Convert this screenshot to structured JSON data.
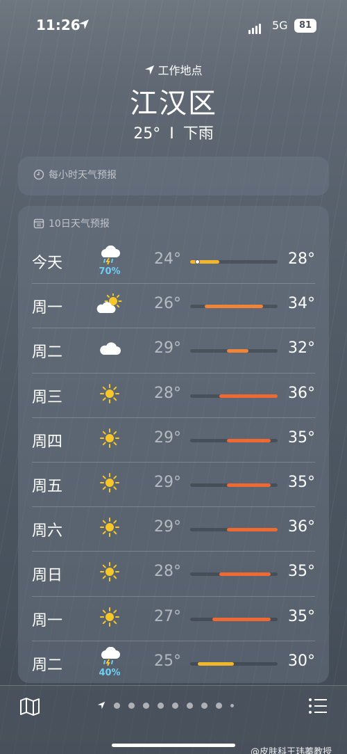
{
  "status": {
    "time": "11:26",
    "network": "5G",
    "battery": "81"
  },
  "header": {
    "location_label": "工作地点",
    "city": "江汉区",
    "temp": "25°",
    "separator": "I",
    "condition": "下雨"
  },
  "hourly": {
    "title": "每小时天气预报"
  },
  "daily": {
    "title": "10日天气预报",
    "range": [
      24,
      36
    ],
    "colors": {
      "cool": "#f2b62a",
      "warm": "#f18436",
      "hot": "#ef6a32",
      "precip": "#6ecff6"
    },
    "rows": [
      {
        "day": "今天",
        "icon": "thunderstorm-icon",
        "precip": "70%",
        "low": "24°",
        "high": "28°",
        "lo_v": 24,
        "hi_v": 28,
        "current": 25
      },
      {
        "day": "周一",
        "icon": "partly-sunny-icon",
        "precip": "",
        "low": "26°",
        "high": "34°",
        "lo_v": 26,
        "hi_v": 34
      },
      {
        "day": "周二",
        "icon": "cloudy-icon",
        "precip": "",
        "low": "29°",
        "high": "32°",
        "lo_v": 29,
        "hi_v": 32
      },
      {
        "day": "周三",
        "icon": "sunny-icon",
        "precip": "",
        "low": "28°",
        "high": "36°",
        "lo_v": 28,
        "hi_v": 36
      },
      {
        "day": "周四",
        "icon": "sunny-icon",
        "precip": "",
        "low": "29°",
        "high": "35°",
        "lo_v": 29,
        "hi_v": 35
      },
      {
        "day": "周五",
        "icon": "sunny-icon",
        "precip": "",
        "low": "29°",
        "high": "35°",
        "lo_v": 29,
        "hi_v": 35
      },
      {
        "day": "周六",
        "icon": "sunny-icon",
        "precip": "",
        "low": "29°",
        "high": "36°",
        "lo_v": 29,
        "hi_v": 36
      },
      {
        "day": "周日",
        "icon": "sunny-icon",
        "precip": "",
        "low": "28°",
        "high": "35°",
        "lo_v": 28,
        "hi_v": 35
      },
      {
        "day": "周一",
        "icon": "sunny-icon",
        "precip": "",
        "low": "27°",
        "high": "35°",
        "lo_v": 27,
        "hi_v": 35
      },
      {
        "day": "周二",
        "icon": "thunderstorm-icon",
        "precip": "40%",
        "low": "25°",
        "high": "30°",
        "lo_v": 25,
        "hi_v": 30
      }
    ]
  },
  "bottom": {
    "page_count": 10,
    "watermark": "@皮肤科王玮蓁教授"
  }
}
